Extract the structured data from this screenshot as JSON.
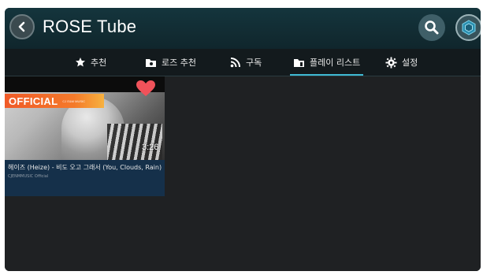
{
  "header": {
    "title": "ROSE Tube",
    "icons": {
      "back": "back-arrow-icon",
      "search": "search-icon",
      "rose": "rose-logo-icon"
    }
  },
  "tabs": [
    {
      "label": "추천",
      "icon": "star-icon"
    },
    {
      "label": "로즈 추천",
      "icon": "folder-icon"
    },
    {
      "label": "구독",
      "icon": "rss-icon"
    },
    {
      "label": "플레이 리스트",
      "icon": "folder-icon",
      "active": true
    },
    {
      "label": "설정",
      "icon": "gear-icon"
    }
  ],
  "video": {
    "badge": "OFFICIAL",
    "badge_sub": "CJ E&M MUSIC",
    "duration": "3:26",
    "title": "헤이즈 (Heize) - 비도 오고 그래서 (You, Clouds, Rain)",
    "channel": "CJENMMUSIC Official",
    "favorited": true
  },
  "colors": {
    "accent": "#3fb9d3",
    "header": "#14353d",
    "heart": "#f0525a",
    "badge": "#f05a28"
  }
}
